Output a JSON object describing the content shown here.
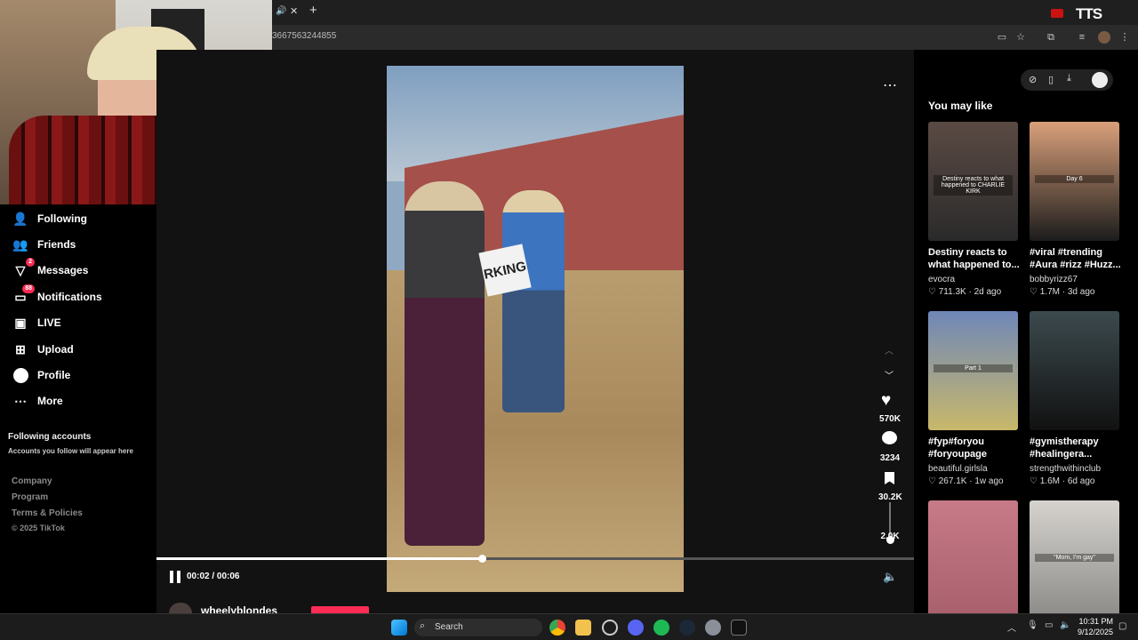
{
  "browser": {
    "url_fragment": "3667563244855",
    "overlay_logo": "TTS"
  },
  "nav": {
    "items": [
      {
        "label": "Following",
        "icon": "following-icon"
      },
      {
        "label": "Friends",
        "icon": "friends-icon"
      },
      {
        "label": "Messages",
        "icon": "messages-icon",
        "badge": "2"
      },
      {
        "label": "Notifications",
        "icon": "notifications-icon",
        "badge": "88"
      },
      {
        "label": "LIVE",
        "icon": "live-icon"
      },
      {
        "label": "Upload",
        "icon": "upload-icon"
      },
      {
        "label": "Profile",
        "icon": "profile-icon"
      },
      {
        "label": "More",
        "icon": "more-icon"
      }
    ],
    "following_accounts_title": "Following accounts",
    "following_accounts_hint": "Accounts you follow will appear here",
    "footer": [
      "Company",
      "Program",
      "Terms & Policies",
      "© 2025 TikTok"
    ]
  },
  "video": {
    "likes": "570K",
    "comments": "3234",
    "saves": "30.2K",
    "shares": "2.0K",
    "time_current": "00:02",
    "time_total": "00:06",
    "progress": 0.43,
    "sign_text": "RKING",
    "author": "wheelyblondes"
  },
  "recommendations": {
    "title": "You may like",
    "cards": [
      {
        "title": "Destiny reacts to what happened to...",
        "author": "evocra",
        "likes": "711.3K",
        "age": "2d ago",
        "thumb_text": "Destiny reacts to what happened to CHARLIE KIRK",
        "colors": [
          "#5b4a44",
          "#2a2a2a"
        ]
      },
      {
        "title": "#viral #trending #Aura #rizz #Huzz...",
        "author": "bobbyrizz67",
        "likes": "1.7M",
        "age": "3d ago",
        "thumb_text": "Day 6",
        "colors": [
          "#d9a07a",
          "#1c1c1c"
        ]
      },
      {
        "title": "#fyp#foryou #foryoupage #tikto...",
        "author": "beautiful.girlsla",
        "likes": "267.1K",
        "age": "1w ago",
        "thumb_text": "Part 1",
        "colors": [
          "#6f87b8",
          "#c8b86a"
        ]
      },
      {
        "title": "#gymistherapy #healingera...",
        "author": "strengthwithinclub",
        "likes": "1.6M",
        "age": "6d ago",
        "thumb_text": "",
        "colors": [
          "#3c4a4e",
          "#111111"
        ]
      },
      {
        "title": "",
        "author": "",
        "likes": "",
        "age": "",
        "thumb_text": "",
        "colors": [
          "#c77a88",
          "#a85f6c"
        ]
      },
      {
        "title": "",
        "author": "",
        "likes": "",
        "age": "",
        "thumb_text": "\"Mom, I'm gay\"",
        "colors": [
          "#d6d3cf",
          "#8b8a86"
        ]
      }
    ]
  },
  "taskbar": {
    "search_label": "Search",
    "time": "10:31 PM",
    "date": "9/12/2025"
  }
}
